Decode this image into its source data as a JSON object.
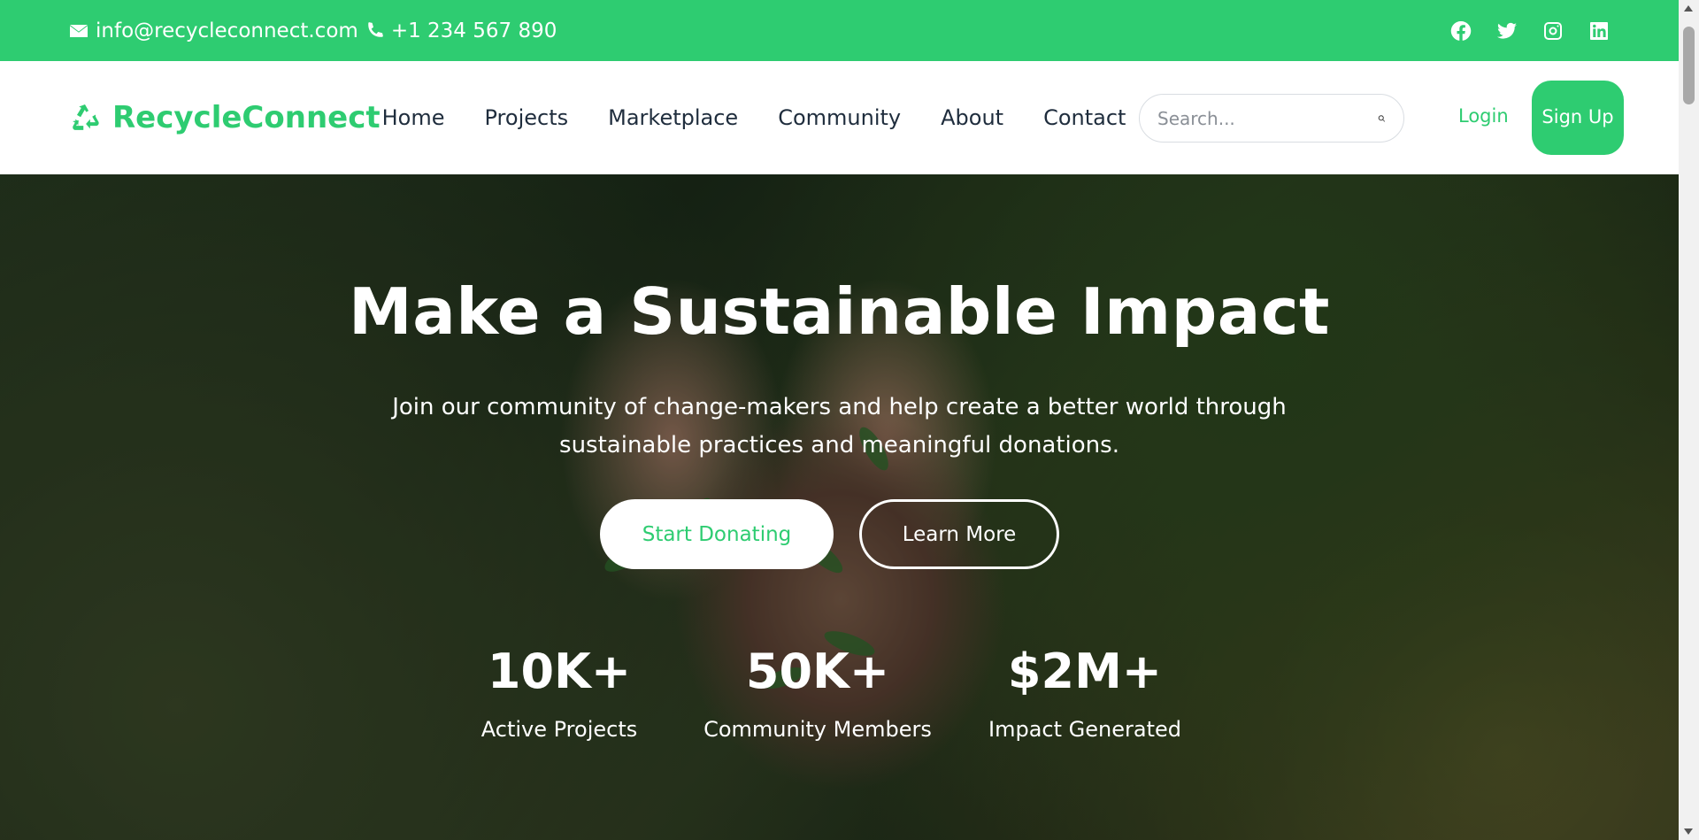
{
  "topbar": {
    "email": "info@recycleconnect.com",
    "phone": "+1 234 567 890",
    "social": [
      "facebook-icon",
      "twitter-icon",
      "instagram-icon",
      "linkedin-icon"
    ]
  },
  "navbar": {
    "brand": "RecycleConnect",
    "links": [
      "Home",
      "Projects",
      "Marketplace",
      "Community",
      "About",
      "Contact"
    ],
    "search_placeholder": "Search...",
    "login": "Login",
    "signup": "Sign Up"
  },
  "hero": {
    "title": "Make a Sustainable Impact",
    "subtitle": "Join our community of change-makers and help create a better world through sustainable practices and meaningful donations.",
    "primary_button": "Start Donating",
    "secondary_button": "Learn More",
    "stats": [
      {
        "value": "10K+",
        "label": "Active Projects"
      },
      {
        "value": "50K+",
        "label": "Community Members"
      },
      {
        "value": "$2M+",
        "label": "Impact Generated"
      }
    ]
  },
  "colors": {
    "accent": "#2ecc71",
    "nav_text": "#1f2d3d",
    "white": "#ffffff"
  }
}
